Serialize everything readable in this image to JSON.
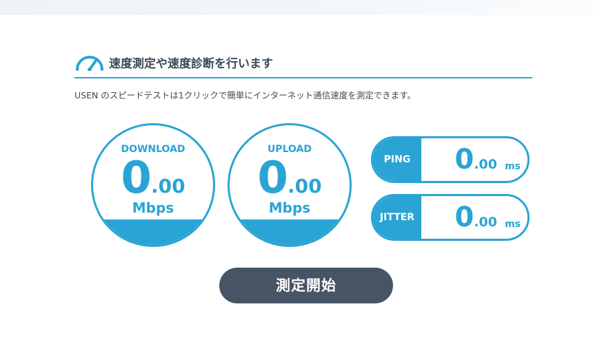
{
  "section": {
    "title": "速度測定や速度診断を行います",
    "icon": "speedometer-icon",
    "description": "USEN のスピードテストは1クリックで簡単にインターネット通信速度を測定できます。"
  },
  "download": {
    "label": "DOWNLOAD",
    "value_int": "0",
    "value_dec": ".00",
    "unit": "Mbps"
  },
  "upload": {
    "label": "UPLOAD",
    "value_int": "0",
    "value_dec": ".00",
    "unit": "Mbps"
  },
  "ping": {
    "label": "PING",
    "value_int": "0",
    "value_dec": ".00",
    "unit": "ms"
  },
  "jitter": {
    "label": "JITTER",
    "value_int": "0",
    "value_dec": ".00",
    "unit": "ms"
  },
  "start_button": {
    "label": "測定開始"
  },
  "colors": {
    "accent": "#2aa4d4",
    "button": "#465465",
    "text": "#3c4a57"
  }
}
